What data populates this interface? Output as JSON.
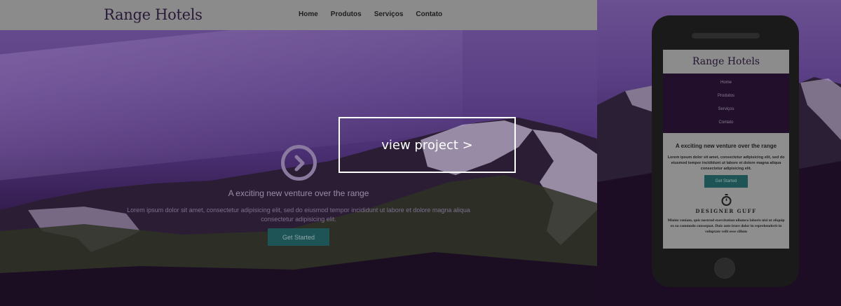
{
  "desktop": {
    "brand": "Range Hotels",
    "nav": [
      "Home",
      "Produtos",
      "Serviços",
      "Contato"
    ],
    "tagline": "A exciting new venture over the range",
    "lorem": "Lorem ipsum dolor sit amet, consectetur adipisicing elit, sed do eiusmod tempor incididunt ut labore et dolore magna aliqua consectetur adipisicing elit.",
    "cta": "Get Started"
  },
  "overlay": {
    "view_project": "view project >"
  },
  "mobile": {
    "brand": "Range Hotels",
    "menu": [
      "Home",
      "Produtos",
      "Serviços",
      "Contato"
    ],
    "tagline": "A exciting new venture over the range",
    "lorem": "Lorem ipsum dolor sit amet, consectetur adipisicing elit, sed do eiusmod tempor incididunt ut labore et dolore magna aliqua consectetur adipisicing elit.",
    "cta": "Get Started",
    "section_heading": "DESIGNER GUFF",
    "section_text": "Minim veniam, quis nostrud exercitation ullamco laboris nisi ut aliquip ex ea commodo consequat. Duis aute irure dolor in reprehenderit in voluptate velit esse cillum"
  },
  "icons": {
    "hero_icon": "chevron-right-circle-icon",
    "section_icon": "stopwatch-icon"
  },
  "colors": {
    "navbar": "#8b8b8b",
    "cta_bg": "#1f5456",
    "overlay_border": "#ffffff",
    "hero_purple": "#5a3f85"
  }
}
